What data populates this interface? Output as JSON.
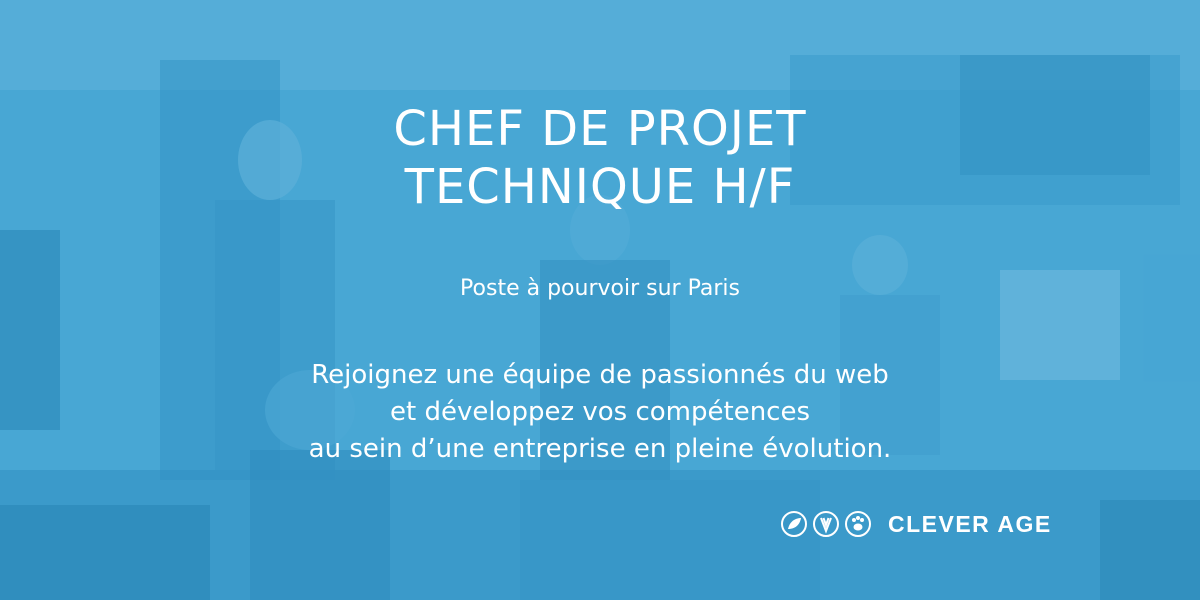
{
  "title_lines": [
    "CHEF DE PROJET",
    "TECHNIQUE H/F"
  ],
  "subtitle": "Poste à pourvoir sur Paris",
  "body_lines": [
    "Rejoignez une équipe de passionnés du web",
    "et développez vos compétences",
    "au sein d’une entreprise en pleine évolution."
  ],
  "logo": {
    "text": "CLEVER AGE",
    "icons": [
      "leaf-badge-icon",
      "wheat-badge-icon",
      "paw-badge-icon"
    ]
  },
  "colors": {
    "overlay": "#349ccd",
    "text": "#ffffff"
  }
}
